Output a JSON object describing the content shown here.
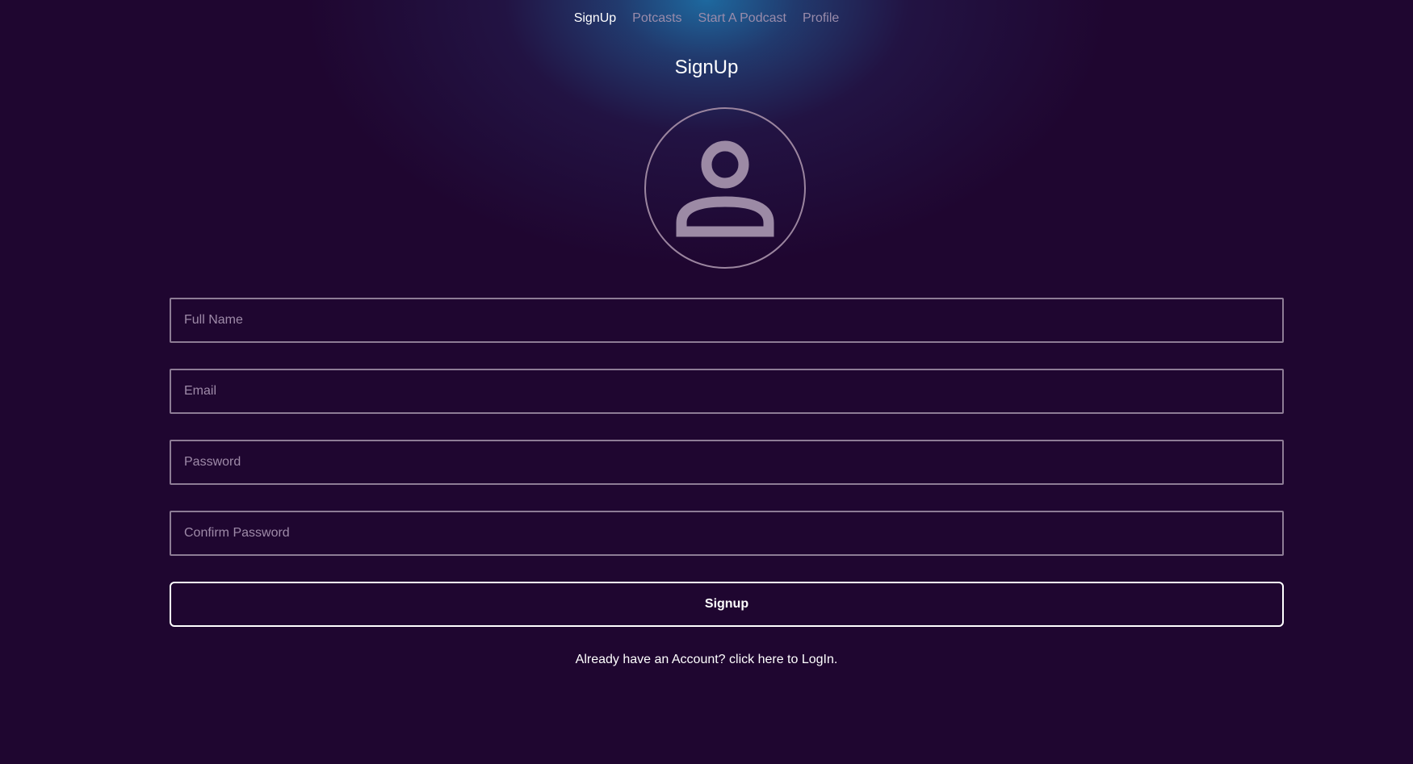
{
  "nav": {
    "items": [
      {
        "label": "SignUp",
        "active": true
      },
      {
        "label": "Potcasts",
        "active": false
      },
      {
        "label": "Start A Podcast",
        "active": false
      },
      {
        "label": "Profile",
        "active": false
      }
    ]
  },
  "page": {
    "title": "SignUp",
    "avatar_icon": "user-icon"
  },
  "form": {
    "full_name": {
      "placeholder": "Full Name",
      "value": ""
    },
    "email": {
      "placeholder": "Email",
      "value": ""
    },
    "password": {
      "placeholder": "Password",
      "value": ""
    },
    "confirm_password": {
      "placeholder": "Confirm Password",
      "value": ""
    },
    "submit_label": "Signup",
    "login_link": "Already have an Account? click here to LogIn."
  },
  "colors": {
    "background": "#1f0630",
    "glow": "#1e6ea5",
    "border": "#8d7c95",
    "text": "#ffffff",
    "muted_text": "#9a8cab"
  }
}
